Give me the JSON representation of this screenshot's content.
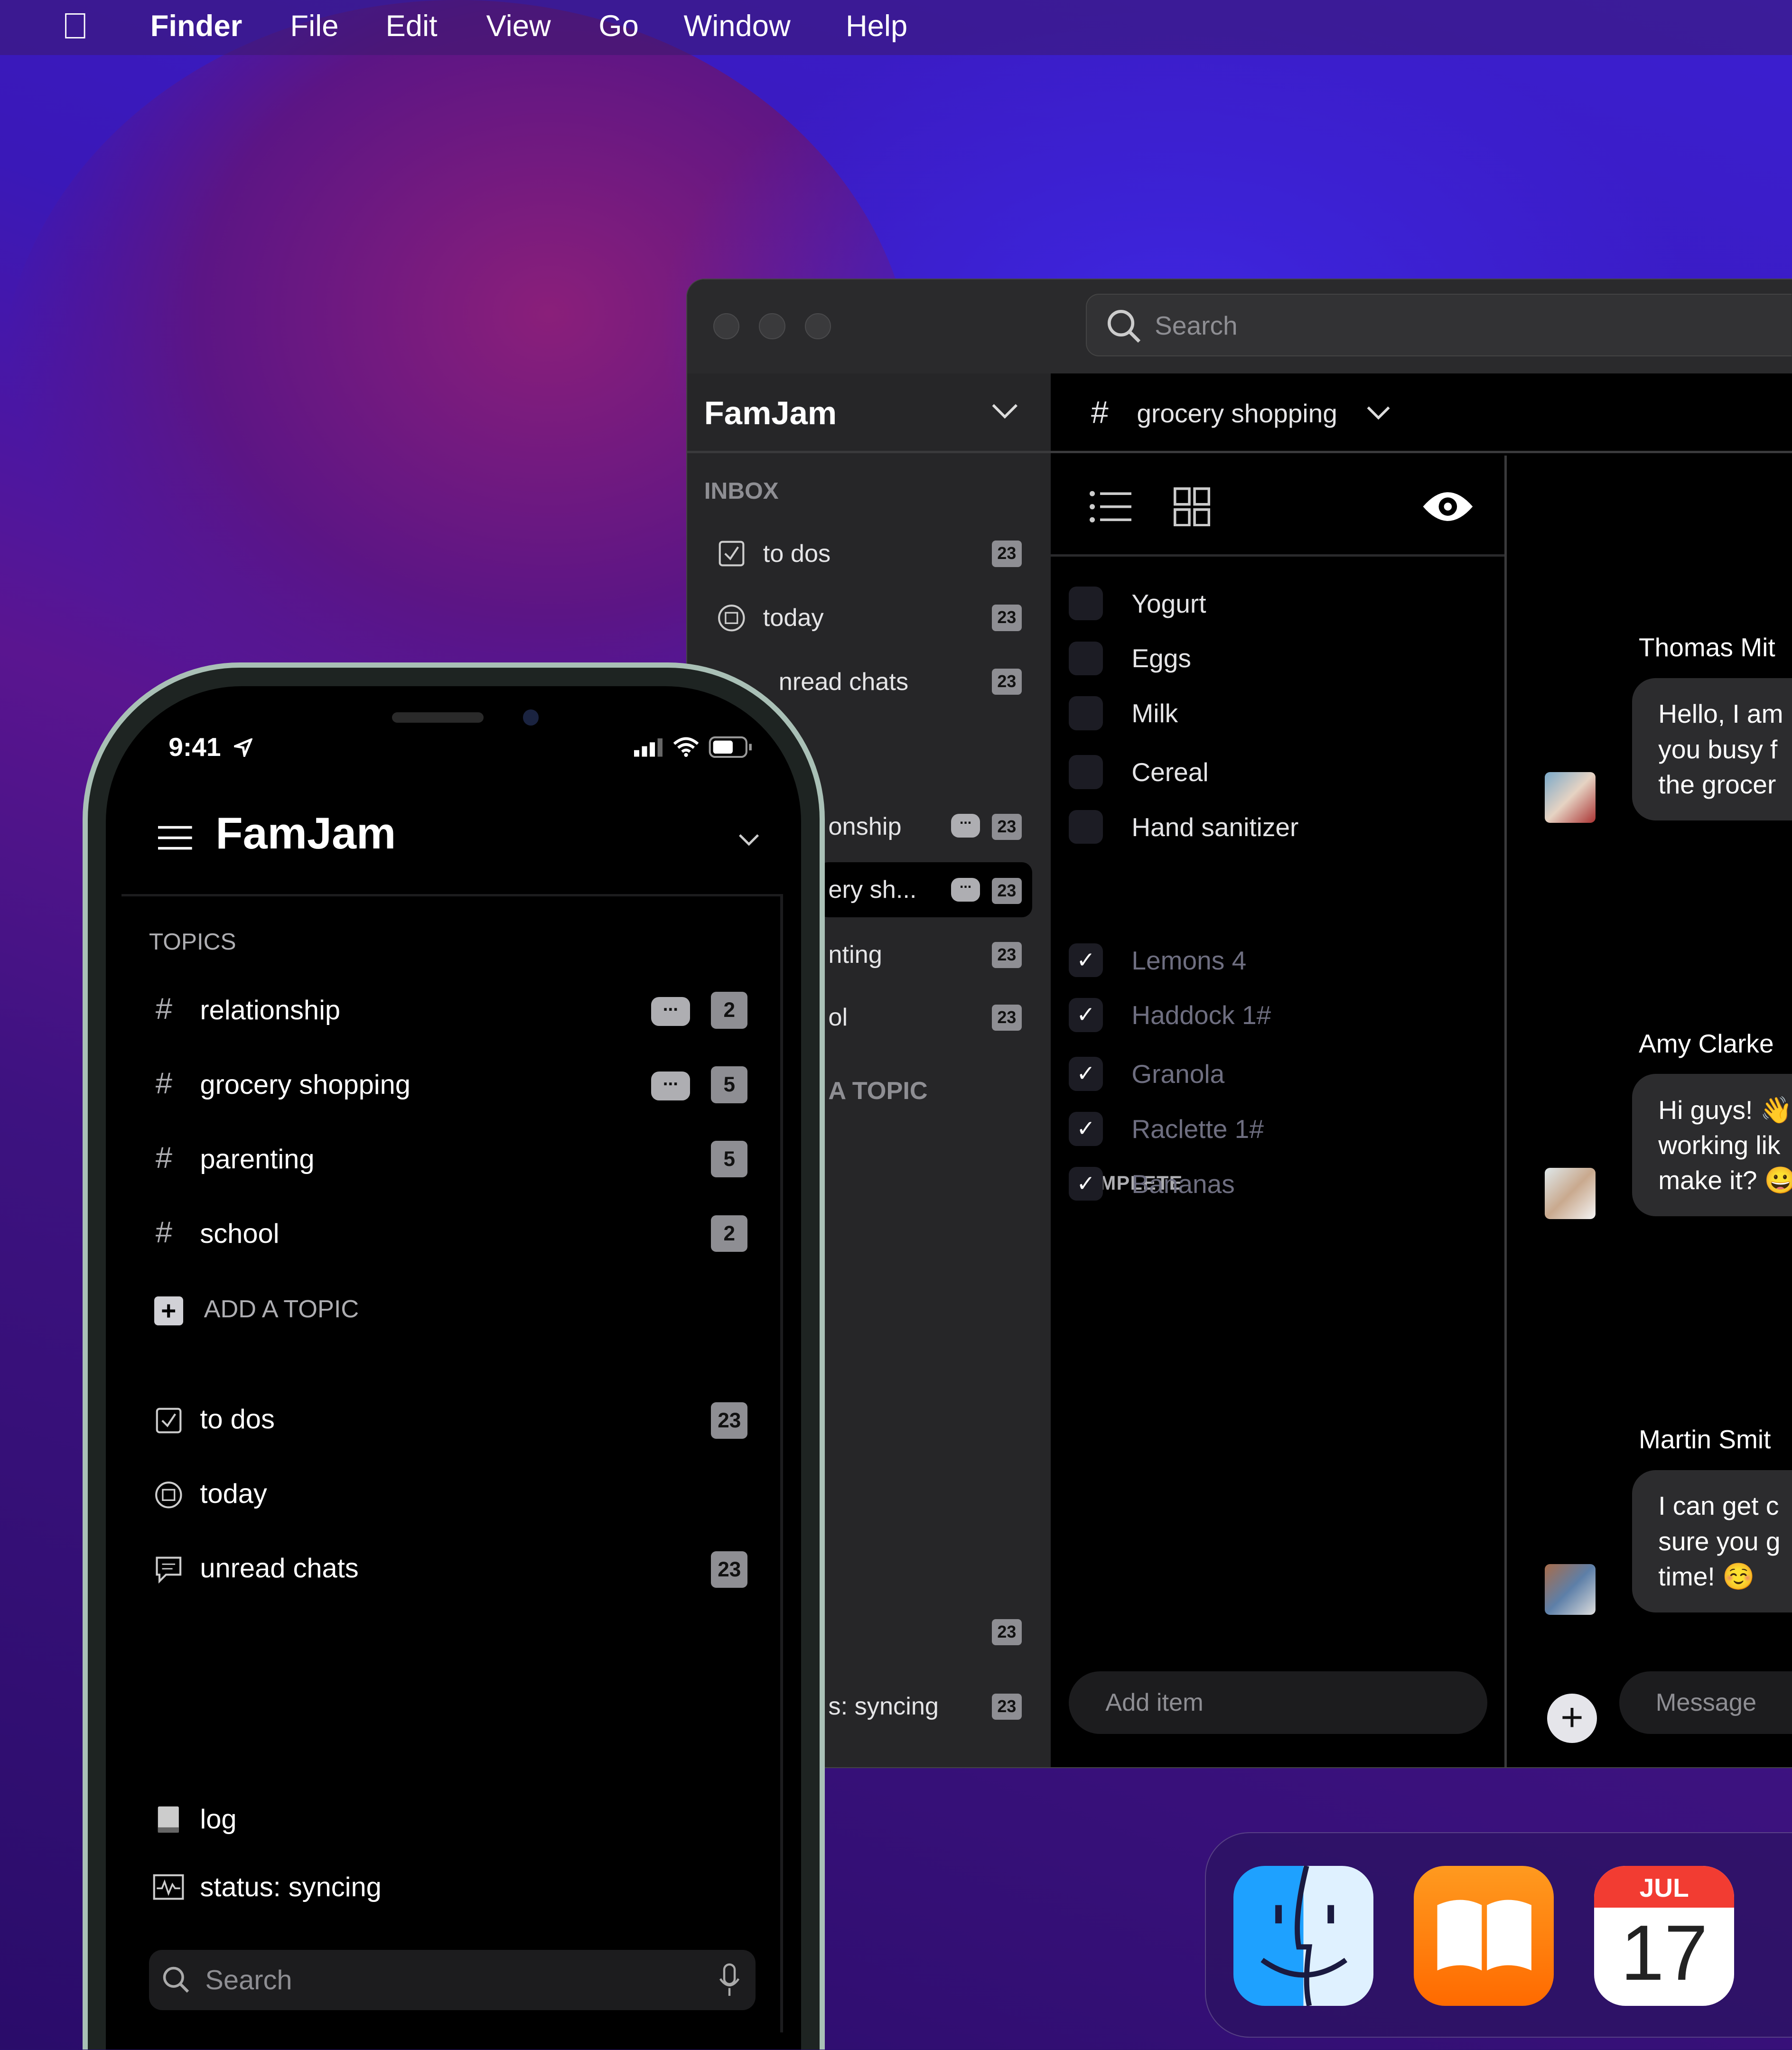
{
  "menubar": {
    "apple_icon": "apple-logo",
    "items": [
      "Finder",
      "File",
      "Edit",
      "View",
      "Go",
      "Window",
      "Help"
    ]
  },
  "window": {
    "search_placeholder": "Search",
    "sidebar": {
      "workspace": "FamJam",
      "inbox_label": "INBOX",
      "inbox": [
        {
          "label": "to dos",
          "count": "23",
          "icon": "checkbox-icon"
        },
        {
          "label": "today",
          "count": "23",
          "icon": "calendar-icon"
        },
        {
          "label": "nread chats",
          "count": "23"
        }
      ],
      "topics": [
        {
          "label": "onship",
          "count": "23"
        },
        {
          "label": "ery sh...",
          "count": "23",
          "selected": true
        },
        {
          "label": "nting",
          "count": "23"
        },
        {
          "label": "ol",
          "count": "23"
        }
      ],
      "add_topic": "A TOPIC",
      "footer": [
        {
          "label": "",
          "count": "23"
        },
        {
          "label": "s: syncing",
          "count": "23"
        }
      ]
    },
    "channel": {
      "hash": "#",
      "name": "grocery shopping"
    },
    "list": {
      "open": [
        "Yogurt",
        "Eggs",
        "Milk",
        "Cereal",
        "Hand sanitizer"
      ],
      "complete_label": "COMPLETE",
      "complete": [
        "Lemons 4",
        "Haddock 1#",
        "Granola",
        "Raclette 1#",
        "Bananas"
      ],
      "add_placeholder": "Add item"
    },
    "chat": {
      "messages": [
        {
          "name": "Thomas Mit",
          "lines": [
            "Hello, I am",
            "you busy f",
            "the grocer"
          ]
        },
        {
          "name": "Amy Clarke",
          "lines": [
            "Hi guys! 👋",
            "working lik",
            "make it? 😀"
          ]
        },
        {
          "name": "Martin Smit",
          "lines": [
            "I can get c",
            "sure you g",
            "time! ☺️"
          ]
        }
      ],
      "message_placeholder": "Message"
    }
  },
  "phone": {
    "time": "9:41",
    "title": "FamJam",
    "topics_label": "TOPICS",
    "topics": [
      {
        "label": "relationship",
        "count": "2",
        "chat": true
      },
      {
        "label": "grocery shopping",
        "count": "5",
        "chat": true
      },
      {
        "label": "parenting",
        "count": "5"
      },
      {
        "label": "school",
        "count": "2"
      }
    ],
    "hash": "#",
    "add_topic": "ADD A TOPIC",
    "inbox": [
      {
        "label": "to dos",
        "count": "23"
      },
      {
        "label": "today"
      },
      {
        "label": "unread chats",
        "count": "23"
      }
    ],
    "footer": [
      {
        "label": "log"
      },
      {
        "label": "status: syncing"
      }
    ],
    "search_placeholder": "Search"
  },
  "dock": {
    "apps": [
      "Finder",
      "Books",
      "Calendar"
    ],
    "calendar_month": "JUL",
    "calendar_day": "17"
  }
}
